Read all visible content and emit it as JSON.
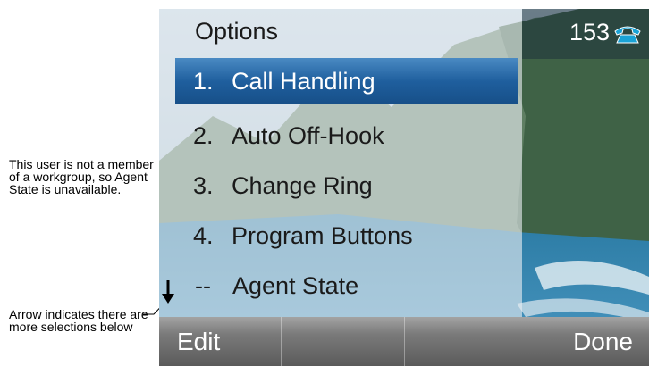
{
  "annotations": {
    "agent_state_note": "This user is not a member of a workgroup, so Agent State is unavailable.",
    "arrow_note": "Arrow indicates there are more selections below"
  },
  "screen": {
    "title": "Options",
    "extension": "153",
    "status_icon": "phone-handset-icon",
    "menu": [
      {
        "number": "1.",
        "label": "Call Handling",
        "selected": true
      },
      {
        "number": "2.",
        "label": "Auto Off-Hook",
        "selected": false
      },
      {
        "number": "3.",
        "label": "Change Ring",
        "selected": false
      },
      {
        "number": "4.",
        "label": "Program Buttons",
        "selected": false
      },
      {
        "number": "--",
        "label": "Agent State",
        "selected": false,
        "disabled": true
      }
    ],
    "scroll_indicator": "down-arrow-icon",
    "softkeys": [
      "Edit",
      "",
      "",
      "Done"
    ]
  },
  "colors": {
    "selection": "#1f5f9e",
    "softkey_bar": "#6e6e6e",
    "phone_icon": "#1aa3d6"
  }
}
